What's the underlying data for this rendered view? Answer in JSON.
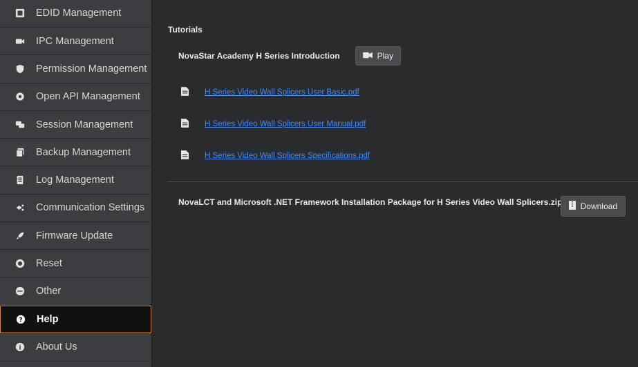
{
  "sidebar": {
    "items": [
      {
        "label": "EDID Management",
        "icon": "edid-icon"
      },
      {
        "label": "IPC Management",
        "icon": "ipc-icon"
      },
      {
        "label": "Permission Management",
        "icon": "shield-icon"
      },
      {
        "label": "Open API Management",
        "icon": "api-icon"
      },
      {
        "label": "Session Management",
        "icon": "chat-icon"
      },
      {
        "label": "Backup Management",
        "icon": "backup-icon"
      },
      {
        "label": "Log Management",
        "icon": "log-icon"
      },
      {
        "label": "Communication Settings",
        "icon": "communication-icon"
      },
      {
        "label": "Firmware Update",
        "icon": "rocket-icon"
      },
      {
        "label": "Reset",
        "icon": "power-icon"
      },
      {
        "label": "Other",
        "icon": "more-icon"
      },
      {
        "label": "Help",
        "icon": "question-icon",
        "active": true
      },
      {
        "label": "About Us",
        "icon": "info-icon"
      }
    ]
  },
  "main": {
    "section_title": "Tutorials",
    "intro": {
      "label": "NovaStar Academy H Series Introduction",
      "play_label": "Play",
      "play_icon": "video-icon"
    },
    "documents": [
      {
        "label": "H Series Video Wall Splicers User Basic.pdf",
        "icon": "document-icon"
      },
      {
        "label": "H Series Video Wall Splicers User Manual.pdf",
        "icon": "document-icon"
      },
      {
        "label": "H Series Video Wall Splicers Specifications.pdf",
        "icon": "document-icon"
      }
    ],
    "package": {
      "label": "NovaLCT and Microsoft .NET Framework Installation Package for H Series Video Wall Splicers.zip",
      "download_label": "Download",
      "download_icon": "zip-icon"
    }
  },
  "colors": {
    "accent_active_border": "#e08a1e",
    "link": "#3f8cff",
    "sidebar_bg": "#3c3d40",
    "main_bg": "#2a2b2d"
  }
}
